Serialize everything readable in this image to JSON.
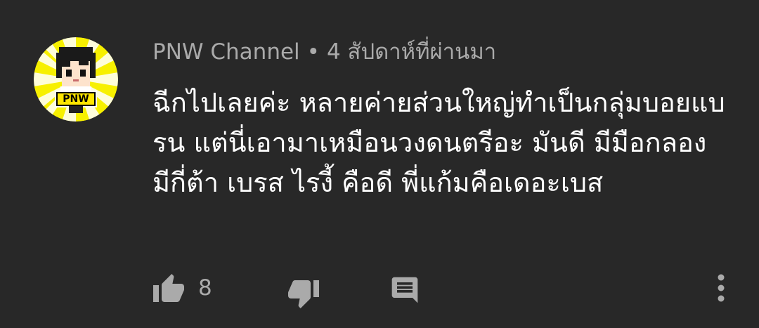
{
  "comment": {
    "author": "PNW Channel",
    "separator": "•",
    "time": "4 สัปดาห์ที่ผ่านมา",
    "text": "ฉีกไปเลยค่ะ หลายค่ายส่วนใหญ่ทำเป็นกลุ่มบอยแบรน แต่นี่เอามาเหมือนวงดนตรีอะ มันดี มีมือกลอง มีกี่ต้า เบรส ไรงี้ คือดี พี่แก้มคือเดอะเบส",
    "avatar_badge": "PNW",
    "like_count": "8"
  },
  "icons": {
    "like": "thumb-up-icon",
    "dislike": "thumb-down-icon",
    "reply": "comment-reply-icon",
    "more": "more-vertical-icon"
  },
  "colors": {
    "background": "#282828",
    "text_primary": "#ffffff",
    "text_secondary": "#aaaaaa",
    "avatar_ring": "#f7f000"
  }
}
